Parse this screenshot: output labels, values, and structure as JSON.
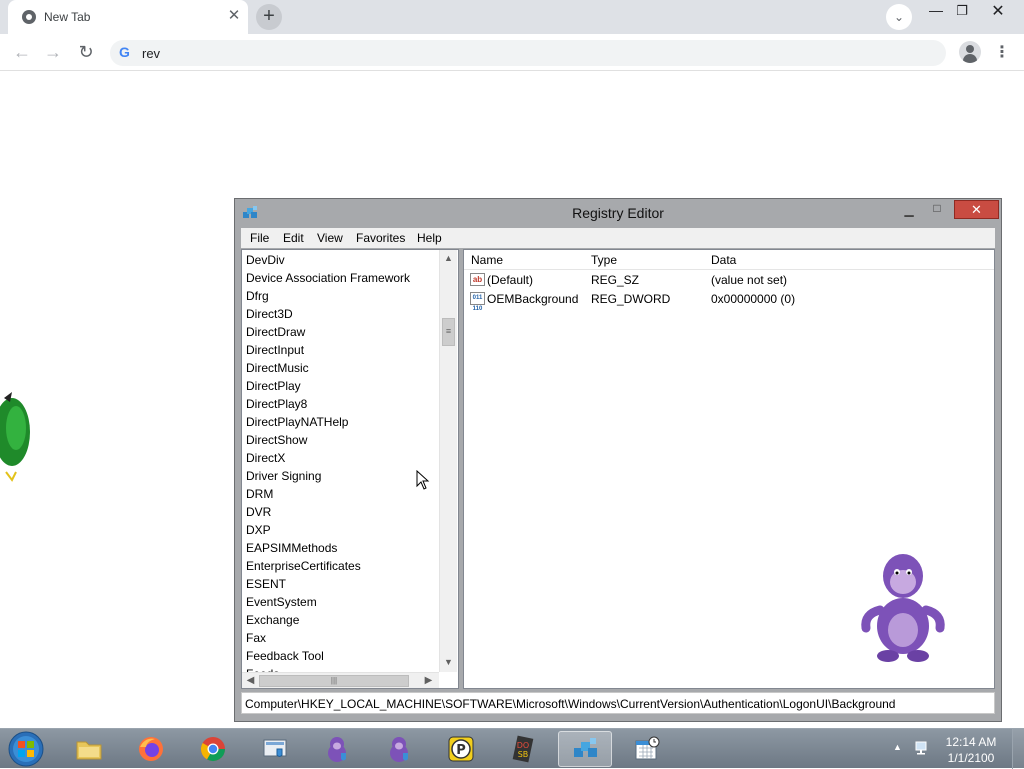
{
  "browser": {
    "tab_title": "New Tab",
    "omnibox_value": "rev",
    "icons": [
      "chrome-icon",
      "close-icon",
      "plus-icon",
      "chevron-down-icon",
      "minimize-icon",
      "restore-icon",
      "back-arrow-icon",
      "forward-arrow-icon",
      "reload-icon",
      "google-icon",
      "profile-icon",
      "more-vert-icon"
    ]
  },
  "regedit": {
    "title": "Registry Editor",
    "menu": [
      "File",
      "Edit",
      "View",
      "Favorites",
      "Help"
    ],
    "tree_items": [
      "DevDiv",
      "Device Association Framework",
      "Dfrg",
      "Direct3D",
      "DirectDraw",
      "DirectInput",
      "DirectMusic",
      "DirectPlay",
      "DirectPlay8",
      "DirectPlayNATHelp",
      "DirectShow",
      "DirectX",
      "Driver Signing",
      "DRM",
      "DVR",
      "DXP",
      "EAPSIMMethods",
      "EnterpriseCertificates",
      "ESENT",
      "EventSystem",
      "Exchange",
      "Fax",
      "Feedback Tool",
      "Feeds"
    ],
    "columns": {
      "name": "Name",
      "type": "Type",
      "data": "Data"
    },
    "values": [
      {
        "name": "(Default)",
        "type": "REG_SZ",
        "data": "(value not set)",
        "icon": "string-value-icon"
      },
      {
        "name": "OEMBackground",
        "type": "REG_DWORD",
        "data": "0x00000000 (0)",
        "icon": "binary-value-icon"
      }
    ],
    "status_path": "Computer\\HKEY_LOCAL_MACHINE\\SOFTWARE\\Microsoft\\Windows\\CurrentVersion\\Authentication\\LogonUI\\Background",
    "close_color": "#c94c42"
  },
  "taskbar": {
    "items": [
      {
        "name": "file-explorer",
        "icon": "folder-icon",
        "active": false
      },
      {
        "name": "firefox",
        "icon": "firefox-icon",
        "active": false
      },
      {
        "name": "chrome",
        "icon": "chrome-icon",
        "active": false
      },
      {
        "name": "control-panel",
        "icon": "control-panel-icon",
        "active": false
      },
      {
        "name": "bonzibuddy-1",
        "icon": "bonzi-icon",
        "active": false
      },
      {
        "name": "bonzibuddy-2",
        "icon": "bonzi-icon",
        "active": false
      },
      {
        "name": "pandora-p",
        "icon": "p-icon",
        "active": false
      },
      {
        "name": "dosbox",
        "icon": "dosbox-icon",
        "active": false
      },
      {
        "name": "regedit",
        "icon": "regedit-icon",
        "active": true
      },
      {
        "name": "calendar",
        "icon": "calendar-icon",
        "active": false
      }
    ],
    "clock_time": "12:14 AM",
    "clock_date": "1/1/2100"
  }
}
